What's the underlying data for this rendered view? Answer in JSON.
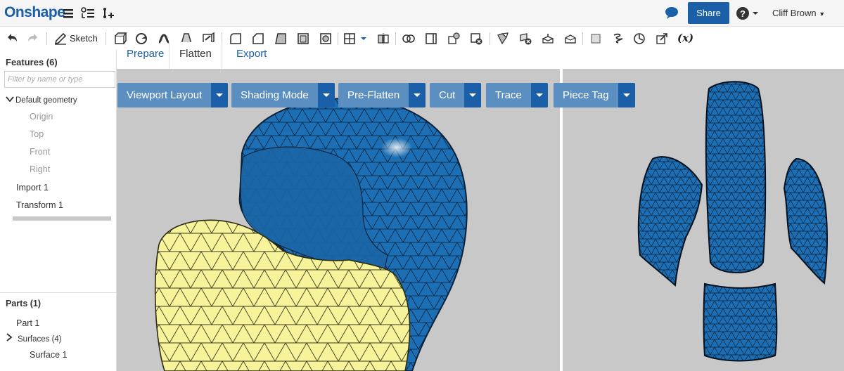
{
  "header": {
    "logo": "Onshape",
    "share_label": "Share",
    "help_icon": "help-icon",
    "user_name": "Cliff Brown"
  },
  "toolbar": {
    "sketch_label": "Sketch",
    "fx_label": "(x)"
  },
  "tabs": [
    {
      "label": "Prepare",
      "active": false
    },
    {
      "label": "Flatten",
      "active": true
    },
    {
      "label": "Export",
      "active": false
    }
  ],
  "sidebar": {
    "features_title": "Features (6)",
    "filter_placeholder": "Filter by name or type",
    "default_geometry": "Default geometry",
    "geometry_items": [
      "Origin",
      "Top",
      "Front",
      "Right"
    ],
    "features": [
      "Import 1",
      "Transform 1"
    ],
    "parts_title": "Parts (1)",
    "part": "Part 1",
    "surfaces": "Surfaces (4)",
    "surface": "Surface 1"
  },
  "viewport_toolbar": [
    {
      "label": "Viewport Layout"
    },
    {
      "label": "Shading Mode"
    },
    {
      "label": "Pre-Flatten"
    },
    {
      "label": "Cut"
    },
    {
      "label": "Trace"
    },
    {
      "label": "Piece Tag"
    }
  ],
  "colors": {
    "brand": "#1a5fa8",
    "mesh_blue": "#1c6fb4",
    "mesh_yellow": "#f6f39a",
    "viewport_bg": "#c8c8c8",
    "vp_button": "#5b8fc2"
  }
}
